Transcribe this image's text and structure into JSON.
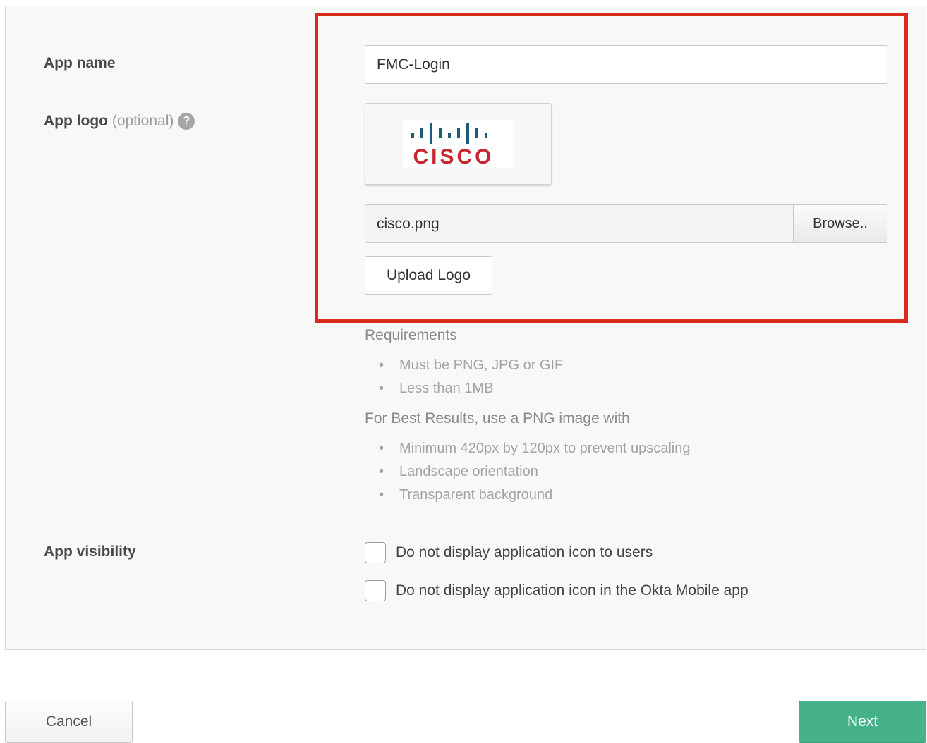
{
  "form": {
    "app_name_label": "App name",
    "app_name_value": "FMC-Login",
    "app_logo_label": "App logo",
    "app_logo_optional": "(optional)",
    "help_glyph": "?",
    "logo_text": "CISCO",
    "file_name": "cisco.png",
    "browse_label": "Browse..",
    "upload_label": "Upload Logo",
    "requirements": {
      "heading": "Requirements",
      "items": [
        "Must be PNG, JPG or GIF",
        "Less than 1MB"
      ]
    },
    "best_results": {
      "heading": "For Best Results, use a PNG image with",
      "items": [
        "Minimum 420px by 120px to prevent upscaling",
        "Landscape orientation",
        "Transparent background"
      ]
    },
    "visibility_label": "App visibility",
    "visibility_options": [
      {
        "label": "Do not display application icon to users",
        "checked": false
      },
      {
        "label": "Do not display application icon in the Okta Mobile app",
        "checked": false
      }
    ]
  },
  "footer": {
    "cancel_label": "Cancel",
    "next_label": "Next"
  },
  "colors": {
    "highlight": "#d92a1c",
    "next_button": "#45b28a",
    "cisco_bars": "#1e5d7a",
    "cisco_text": "#c6262d"
  },
  "icons": {
    "help": "question-circle-icon",
    "cisco_logo": "cisco-logo"
  }
}
